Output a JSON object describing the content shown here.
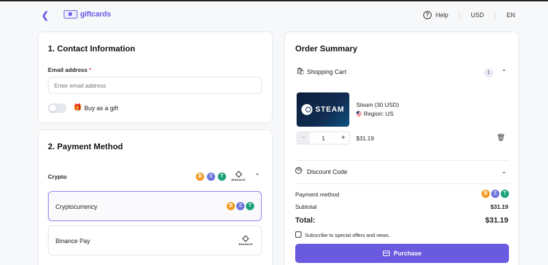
{
  "header": {
    "back_icon": "chevron-left-icon",
    "logo_text": "giftcards",
    "help_label": "Help",
    "currency": "USD",
    "language": "EN"
  },
  "contact": {
    "title": "1. Contact Information",
    "email_label": "Email address",
    "required_mark": "*",
    "email_placeholder": "Enter email address",
    "email_value": "",
    "gift_toggle_on": false,
    "gift_label": "Buy as a gift"
  },
  "payment": {
    "title": "2. Payment Method",
    "group_label": "Crypto",
    "binance_logo_text": "BINANCE",
    "options": [
      {
        "label": "Cryptocurrency",
        "selected": true
      },
      {
        "label": "Binance Pay",
        "selected": false
      }
    ],
    "coins": {
      "btc": "₿",
      "eth": "Ξ",
      "usdt": "T"
    }
  },
  "summary": {
    "title": "Order Summary",
    "cart_label": "Shopping Cart",
    "cart_count": "1",
    "item": {
      "name": "Steam (30 USD)",
      "region": "Region: US",
      "image_text": "STEAM",
      "quantity": "1",
      "price": "$31.19"
    },
    "discount_label": "Discount Code",
    "payment_method_label": "Payment method",
    "subtotal_label": "Subtotal",
    "subtotal_value": "$31.19",
    "total_label": "Total:",
    "total_value": "$31.19",
    "subscribe_label": "Subscribe to special offers and news.",
    "purchase_label": "Purchase"
  },
  "colors": {
    "accent": "#6a5ae0",
    "btc": "#f39a1f",
    "eth": "#6c74d9",
    "usdt": "#1ba27a"
  }
}
